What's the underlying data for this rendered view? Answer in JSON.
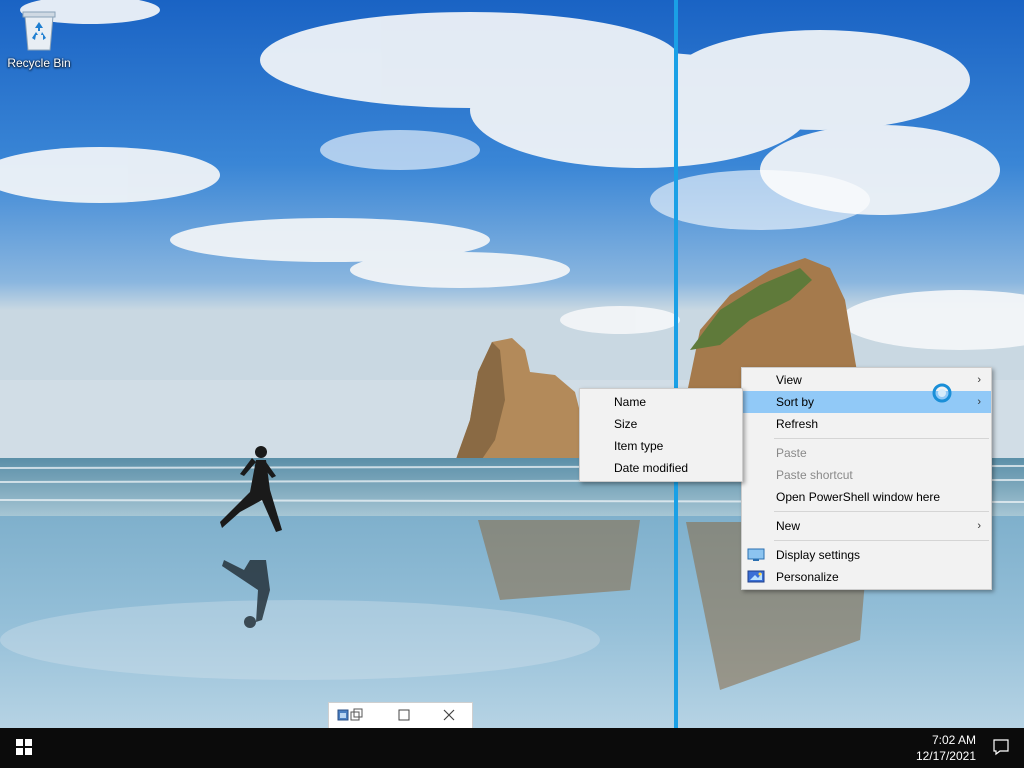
{
  "desktop": {
    "icons": [
      {
        "label": "Recycle Bin",
        "icon": "recycle-bin-icon"
      }
    ]
  },
  "context_menu": {
    "items": [
      {
        "label": "View",
        "has_submenu": true
      },
      {
        "label": "Sort by",
        "has_submenu": true,
        "highlighted": true
      },
      {
        "label": "Refresh"
      },
      {
        "label": "Paste",
        "disabled": true
      },
      {
        "label": "Paste shortcut",
        "disabled": true
      },
      {
        "label": "Open PowerShell window here"
      },
      {
        "label": "New",
        "has_submenu": true
      },
      {
        "label": "Display settings",
        "icon": "display-settings-icon"
      },
      {
        "label": "Personalize",
        "icon": "personalize-icon"
      }
    ],
    "submenu_arrow": "›"
  },
  "sort_by_submenu": {
    "items": [
      {
        "label": "Name"
      },
      {
        "label": "Size"
      },
      {
        "label": "Item type"
      },
      {
        "label": "Date modified"
      }
    ]
  },
  "mini_window": {
    "buttons": [
      "restore-icon",
      "maximize-icon",
      "close-icon"
    ]
  },
  "taskbar": {
    "start_icon": "windows-logo-icon",
    "clock_time": "7:02 AM",
    "clock_date": "12/17/2021",
    "notification_icon": "action-center-icon"
  },
  "colors": {
    "split_line": "#1aa0e6",
    "menu_highlight": "#91c9f7",
    "taskbar": "#0b0b0b"
  }
}
